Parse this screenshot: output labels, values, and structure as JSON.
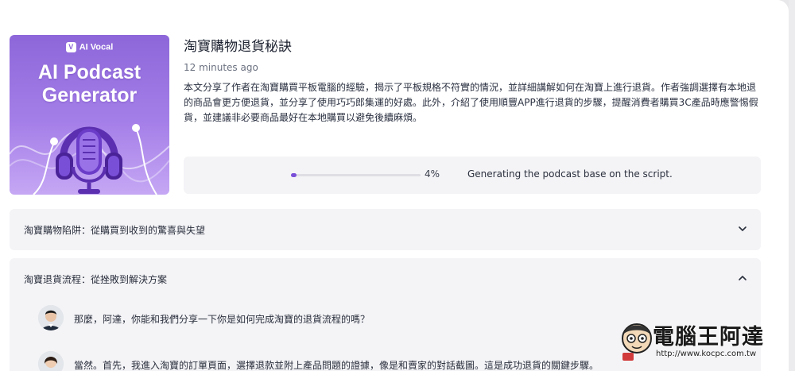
{
  "episode": {
    "title": "淘寶購物退貨秘訣",
    "time_ago": "12 minutes ago",
    "summary": "本文分享了作者在淘寶購買平板電腦的經驗，揭示了平板規格不符實的情況，並詳細講解如何在淘寶上進行退貨。作者強調選擇有本地退的商品會更方便退貨，並分享了使用巧巧郎集運的好處。此外，介紹了使用順豐APP進行退貨的步驟，提醒消費者購買3C產品時應警惕假貨，並建議非必要商品最好在本地購買以避免後續麻煩。"
  },
  "cover": {
    "brand": "AI Vocal",
    "brand_logo_letter": "V",
    "title": "AI Podcast\nGenerator",
    "icon": "microphone-with-headphones"
  },
  "progress": {
    "percent": 4,
    "percent_label": "4%",
    "status": "Generating the podcast base on the script."
  },
  "sections": [
    {
      "title": "淘寶購物陷阱：從購買到收到的驚喜與失望",
      "expanded": false,
      "icon": "chevron-down-icon"
    },
    {
      "title": "淘寶退貨流程：從挫敗到解決方案",
      "expanded": true,
      "icon": "chevron-up-icon",
      "messages": [
        {
          "speaker": "host-male",
          "text": "那麼，阿達，你能和我們分享一下你是如何完成淘寶的退貨流程的嗎？"
        },
        {
          "speaker": "host-female",
          "text": "當然。首先，我進入淘寶的訂單頁面，選擇退款並附上產品問題的證據，像是和賣家的對話截圖。這是成功退貨的關鍵步驟。"
        }
      ]
    }
  ],
  "watermark": {
    "title": "電腦王阿達",
    "url": "http://www.kocpc.com.tw"
  },
  "colors": {
    "accent": "#7a4fd8",
    "panel": "#f4f4f7",
    "cover_purple": "#9b74e2"
  }
}
